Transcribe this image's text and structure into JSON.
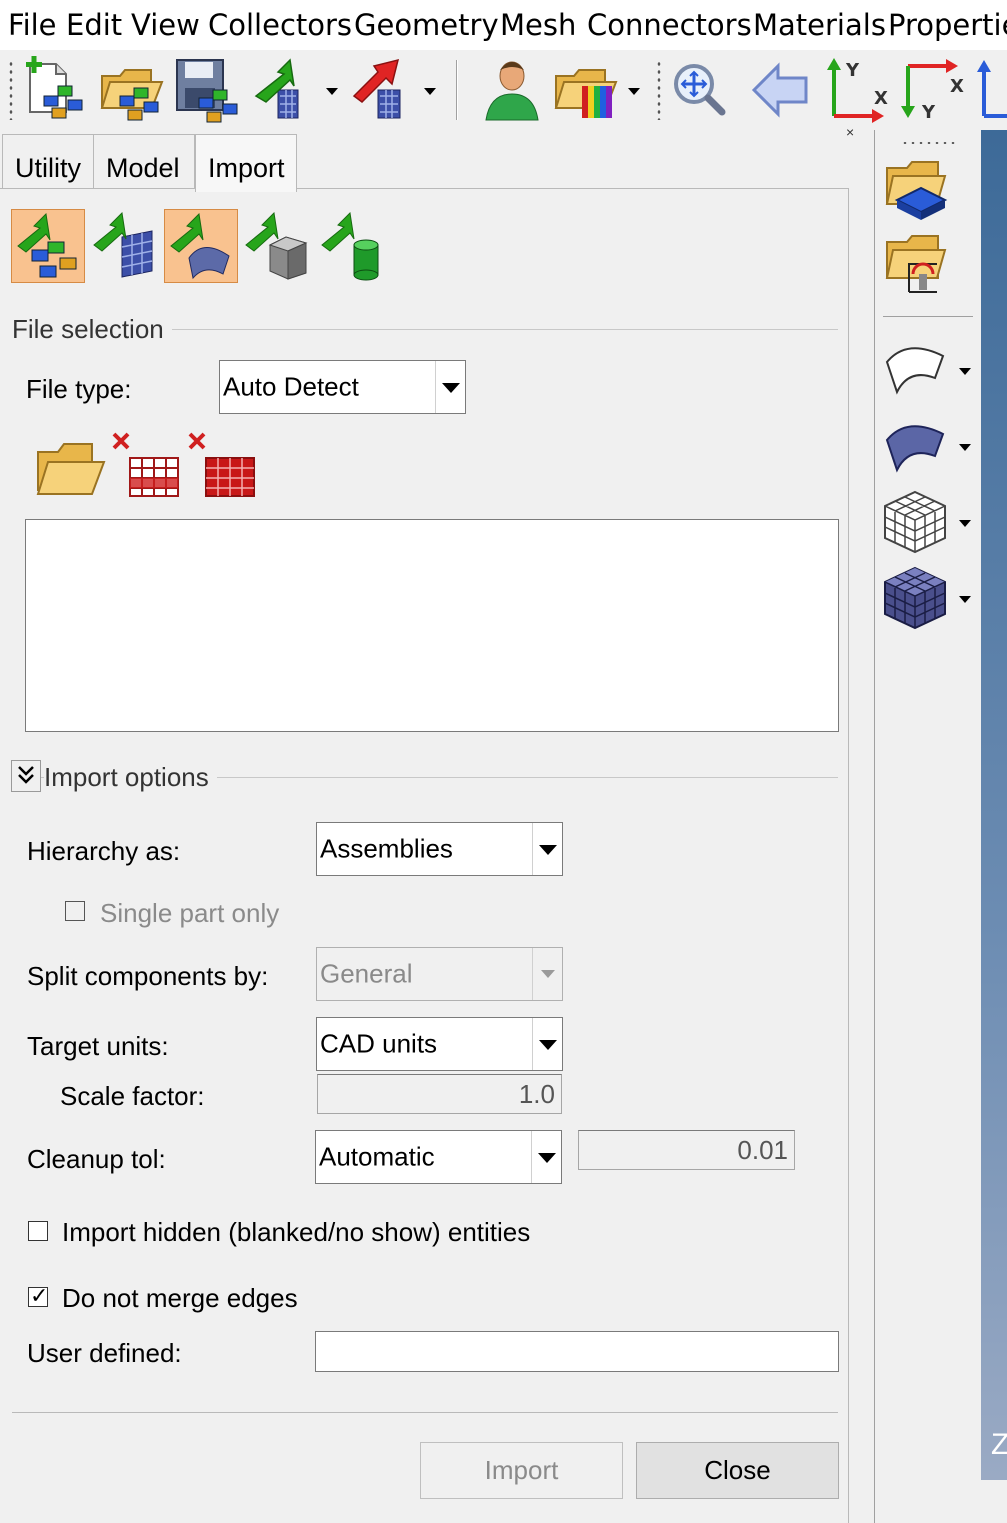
{
  "menubar": {
    "items": [
      "File",
      "Edit",
      "View",
      "Collectors",
      "Geometry",
      "Mesh",
      "Connectors",
      "Materials",
      "Propertie"
    ]
  },
  "toolbar": {
    "icons": [
      "new-model-icon",
      "open-model-icon",
      "save-model-icon",
      "import-icon",
      "export-icon",
      "user-profile-icon",
      "open-results-icon",
      "zoom-icon",
      "back-icon",
      "axis-y-x-icon",
      "axis-x-y-icon",
      "axis-z-icon"
    ],
    "axis_y_label": "Y",
    "axis_x_label": "X",
    "axis_x2_label": "X",
    "axis_y2_label": "Y"
  },
  "panel": {
    "close_glyph": "×",
    "tabs": [
      {
        "label": "Utility",
        "active": false
      },
      {
        "label": "Model",
        "active": false
      },
      {
        "label": "Import",
        "active": true
      }
    ],
    "sub_icons": [
      "import-model-icon",
      "import-fe-icon",
      "import-geometry-icon",
      "import-solid-icon",
      "import-connector-icon"
    ],
    "file_selection": {
      "group_label": "File selection",
      "file_type_label": "File type:",
      "file_type_value": "Auto Detect"
    },
    "import_options": {
      "group_label": "Import options",
      "hierarchy_label": "Hierarchy as:",
      "hierarchy_value": "Assemblies",
      "single_part_label": "Single part only",
      "single_part_checked": false,
      "split_label": "Split components by:",
      "split_value": "General",
      "target_units_label": "Target units:",
      "target_units_value": "CAD units",
      "scale_factor_label": "Scale factor:",
      "scale_factor_value": "1.0",
      "cleanup_label": "Cleanup tol:",
      "cleanup_value": "Automatic",
      "cleanup_tol_value": "0.01",
      "import_hidden_label": "Import hidden (blanked/no show) entities",
      "import_hidden_checked": false,
      "no_merge_label": "Do not merge edges",
      "no_merge_checked": true,
      "checkmark_glyph": "✓",
      "user_defined_label": "User defined:",
      "user_defined_value": ""
    },
    "buttons": {
      "import_label": "Import",
      "close_label": "Close"
    }
  },
  "right_strip": {
    "icons": [
      "folder-component-icon",
      "folder-load-icon",
      "surface-outline-icon",
      "surface-solid-icon",
      "mesh-wireframe-icon",
      "mesh-solid-icon"
    ]
  },
  "viewport": {
    "axis_label": "Z"
  },
  "colors": {
    "active_subtab": "#f9c28f",
    "viewport_blue": "#3d6a98",
    "arrow_green": "#27a51b",
    "arrow_red": "#e02424"
  }
}
